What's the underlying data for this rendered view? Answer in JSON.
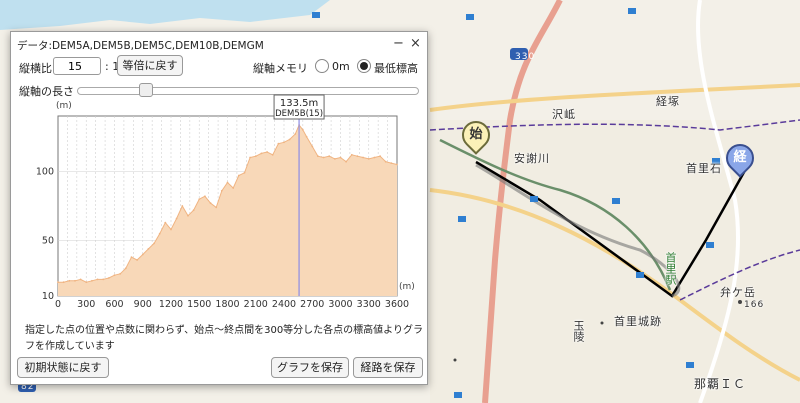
{
  "map": {
    "labels": {
      "sawaoka": "沢岻",
      "kyozuka": "経塚",
      "asatogawa": "安謝川",
      "shuri_ishi": "首里石",
      "shuri_station": "首里駅",
      "benga_dake": "弁ケ岳",
      "elevation_166": "166",
      "shurijo": "首里城跡",
      "tamaudun": "玉陵",
      "naha_ic": "那覇ＩＣ",
      "route_330": "330",
      "route_82": "82"
    },
    "start_marker": "始",
    "end_marker": "経"
  },
  "dialog": {
    "title": "データ:DEM5A,DEM5B,DEM5C,DEM10B,DEMGM",
    "minimize": "−",
    "close": "×",
    "ratio_label": "縦横比",
    "ratio_value": "15",
    "ratio_suffix": ": 1",
    "reset_ratio_button": "等倍に戻す",
    "axis_memory_label": "縦軸メモリ",
    "option_zero": "0m",
    "option_min": "最低標高",
    "option_selected": "最低標高",
    "axis_length_label": "縦軸の長さ",
    "note": "指定した点の位置や点数に関わらず、始点～終点間を300等分した各点の標高値よりグラフを作成しています",
    "reset_button": "初期状態に戻す",
    "save_graph_button": "グラフを保存",
    "save_route_button": "経路を保存"
  },
  "chart_data": {
    "type": "area",
    "xlabel": "(m)",
    "ylabel": "(m)",
    "xlim": [
      0,
      3600
    ],
    "ylim": [
      10,
      140
    ],
    "xticks": [
      0,
      300,
      600,
      900,
      1200,
      1500,
      1800,
      2100,
      2400,
      2700,
      3000,
      3300,
      3600
    ],
    "yticks": [
      10,
      50,
      100
    ],
    "tooltip": {
      "x": 2560,
      "value_label": "133.5m",
      "source_label": "DEM5B(15)"
    },
    "colors": {
      "fill": "#f8d8b8",
      "line": "#f0b482",
      "cursor": "#8c8ce6"
    },
    "x": [
      0,
      60,
      120,
      180,
      240,
      300,
      360,
      420,
      480,
      540,
      600,
      660,
      720,
      780,
      840,
      900,
      960,
      1020,
      1080,
      1140,
      1200,
      1260,
      1320,
      1380,
      1440,
      1500,
      1560,
      1620,
      1680,
      1740,
      1800,
      1860,
      1920,
      1980,
      2040,
      2100,
      2160,
      2220,
      2280,
      2340,
      2400,
      2460,
      2520,
      2560,
      2600,
      2640,
      2700,
      2760,
      2820,
      2880,
      2940,
      3000,
      3060,
      3120,
      3180,
      3240,
      3300,
      3360,
      3420,
      3480,
      3540,
      3600
    ],
    "y": [
      20,
      20,
      21,
      21,
      22,
      20,
      21,
      22,
      22,
      23,
      25,
      26,
      30,
      38,
      36,
      40,
      44,
      48,
      55,
      63,
      58,
      66,
      75,
      68,
      72,
      80,
      82,
      77,
      74,
      86,
      92,
      88,
      97,
      99,
      110,
      111,
      113,
      114,
      112,
      120,
      121,
      123,
      127,
      133.5,
      130,
      125,
      118,
      111,
      110,
      111,
      109,
      110,
      107,
      112,
      111,
      110,
      109,
      110,
      111,
      107,
      106,
      105
    ]
  }
}
